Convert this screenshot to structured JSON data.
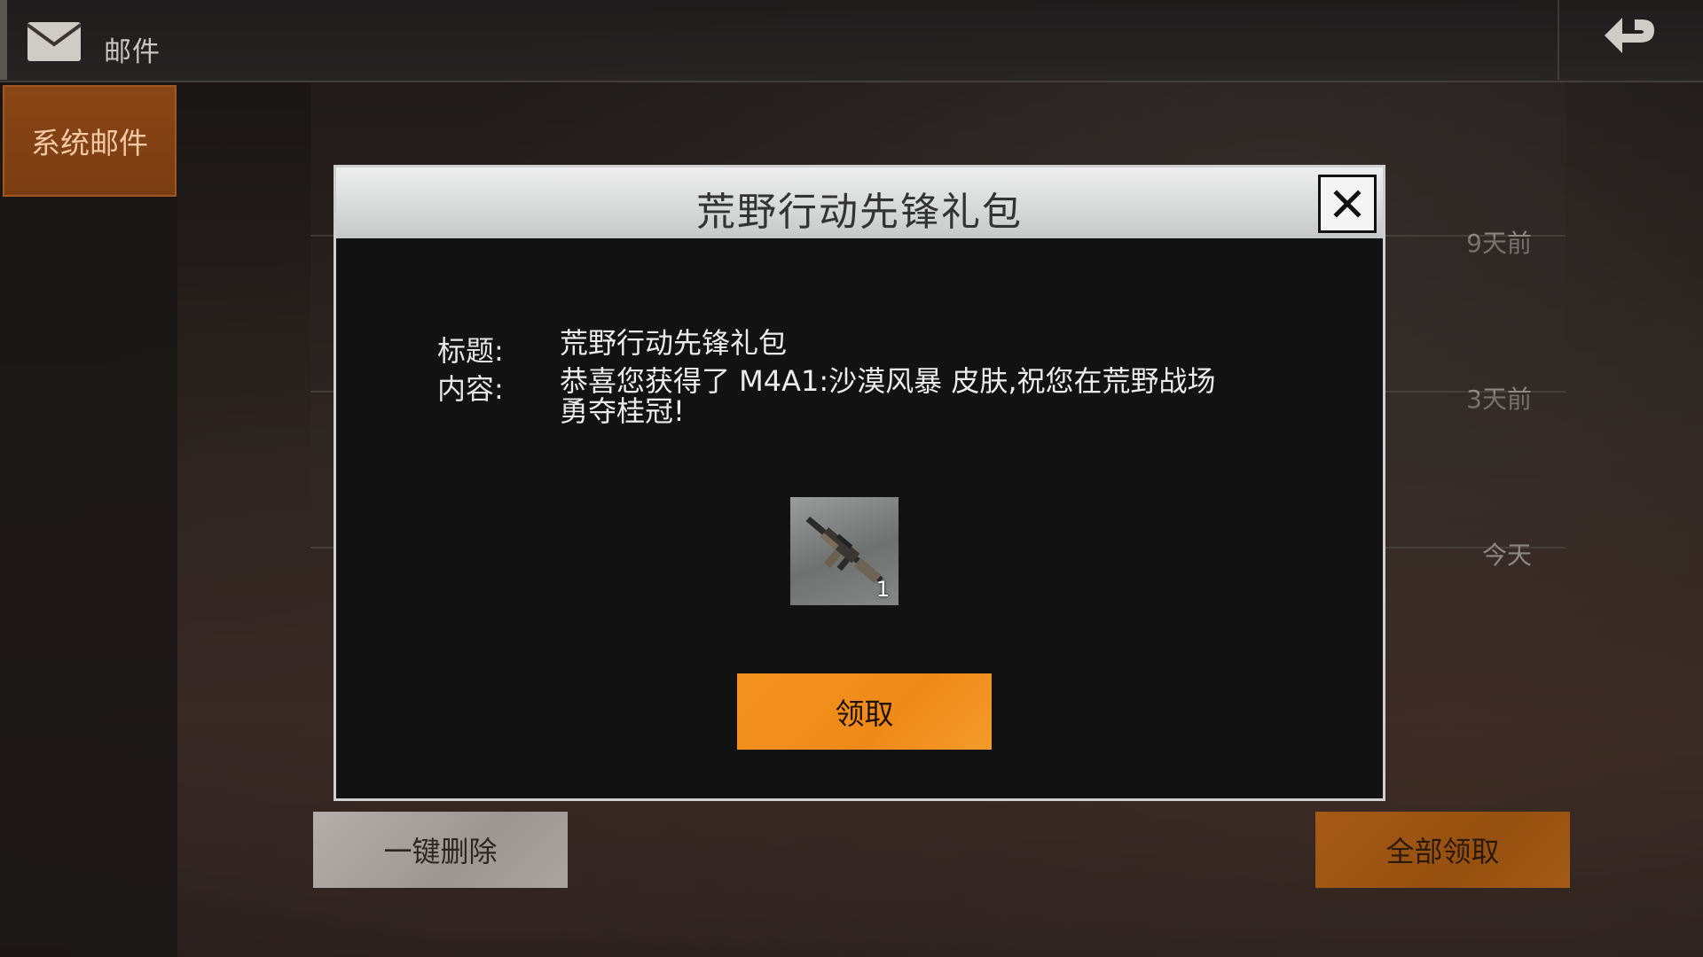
{
  "header": {
    "title": "邮件",
    "mail_icon": "envelope-icon",
    "back_icon": "return-arrow-icon"
  },
  "sidebar": {
    "tabs": [
      {
        "label": "系统邮件",
        "selected": true
      }
    ]
  },
  "mail_list": {
    "rows": [
      {
        "time": "9天前"
      },
      {
        "time": "3天前"
      },
      {
        "time": "今天"
      }
    ]
  },
  "footer": {
    "delete_all_label": "一键删除",
    "claim_all_label": "全部领取"
  },
  "modal": {
    "title": "荒野行动先锋礼包",
    "close_icon": "close-x-icon",
    "subject_label": "标题:",
    "subject_value": "荒野行动先锋礼包",
    "content_label": "内容:",
    "content_line1": "恭喜您获得了 M4A1:沙漠风暴 皮肤,祝您在荒野战场",
    "content_line2": "勇夺桂冠!",
    "reward": {
      "icon": "rifle-icon",
      "count": "1"
    },
    "claim_label": "领取"
  },
  "colors": {
    "accent_orange": "#f5931f",
    "tab_orange": "#8a4616",
    "modal_bg": "#121212"
  }
}
